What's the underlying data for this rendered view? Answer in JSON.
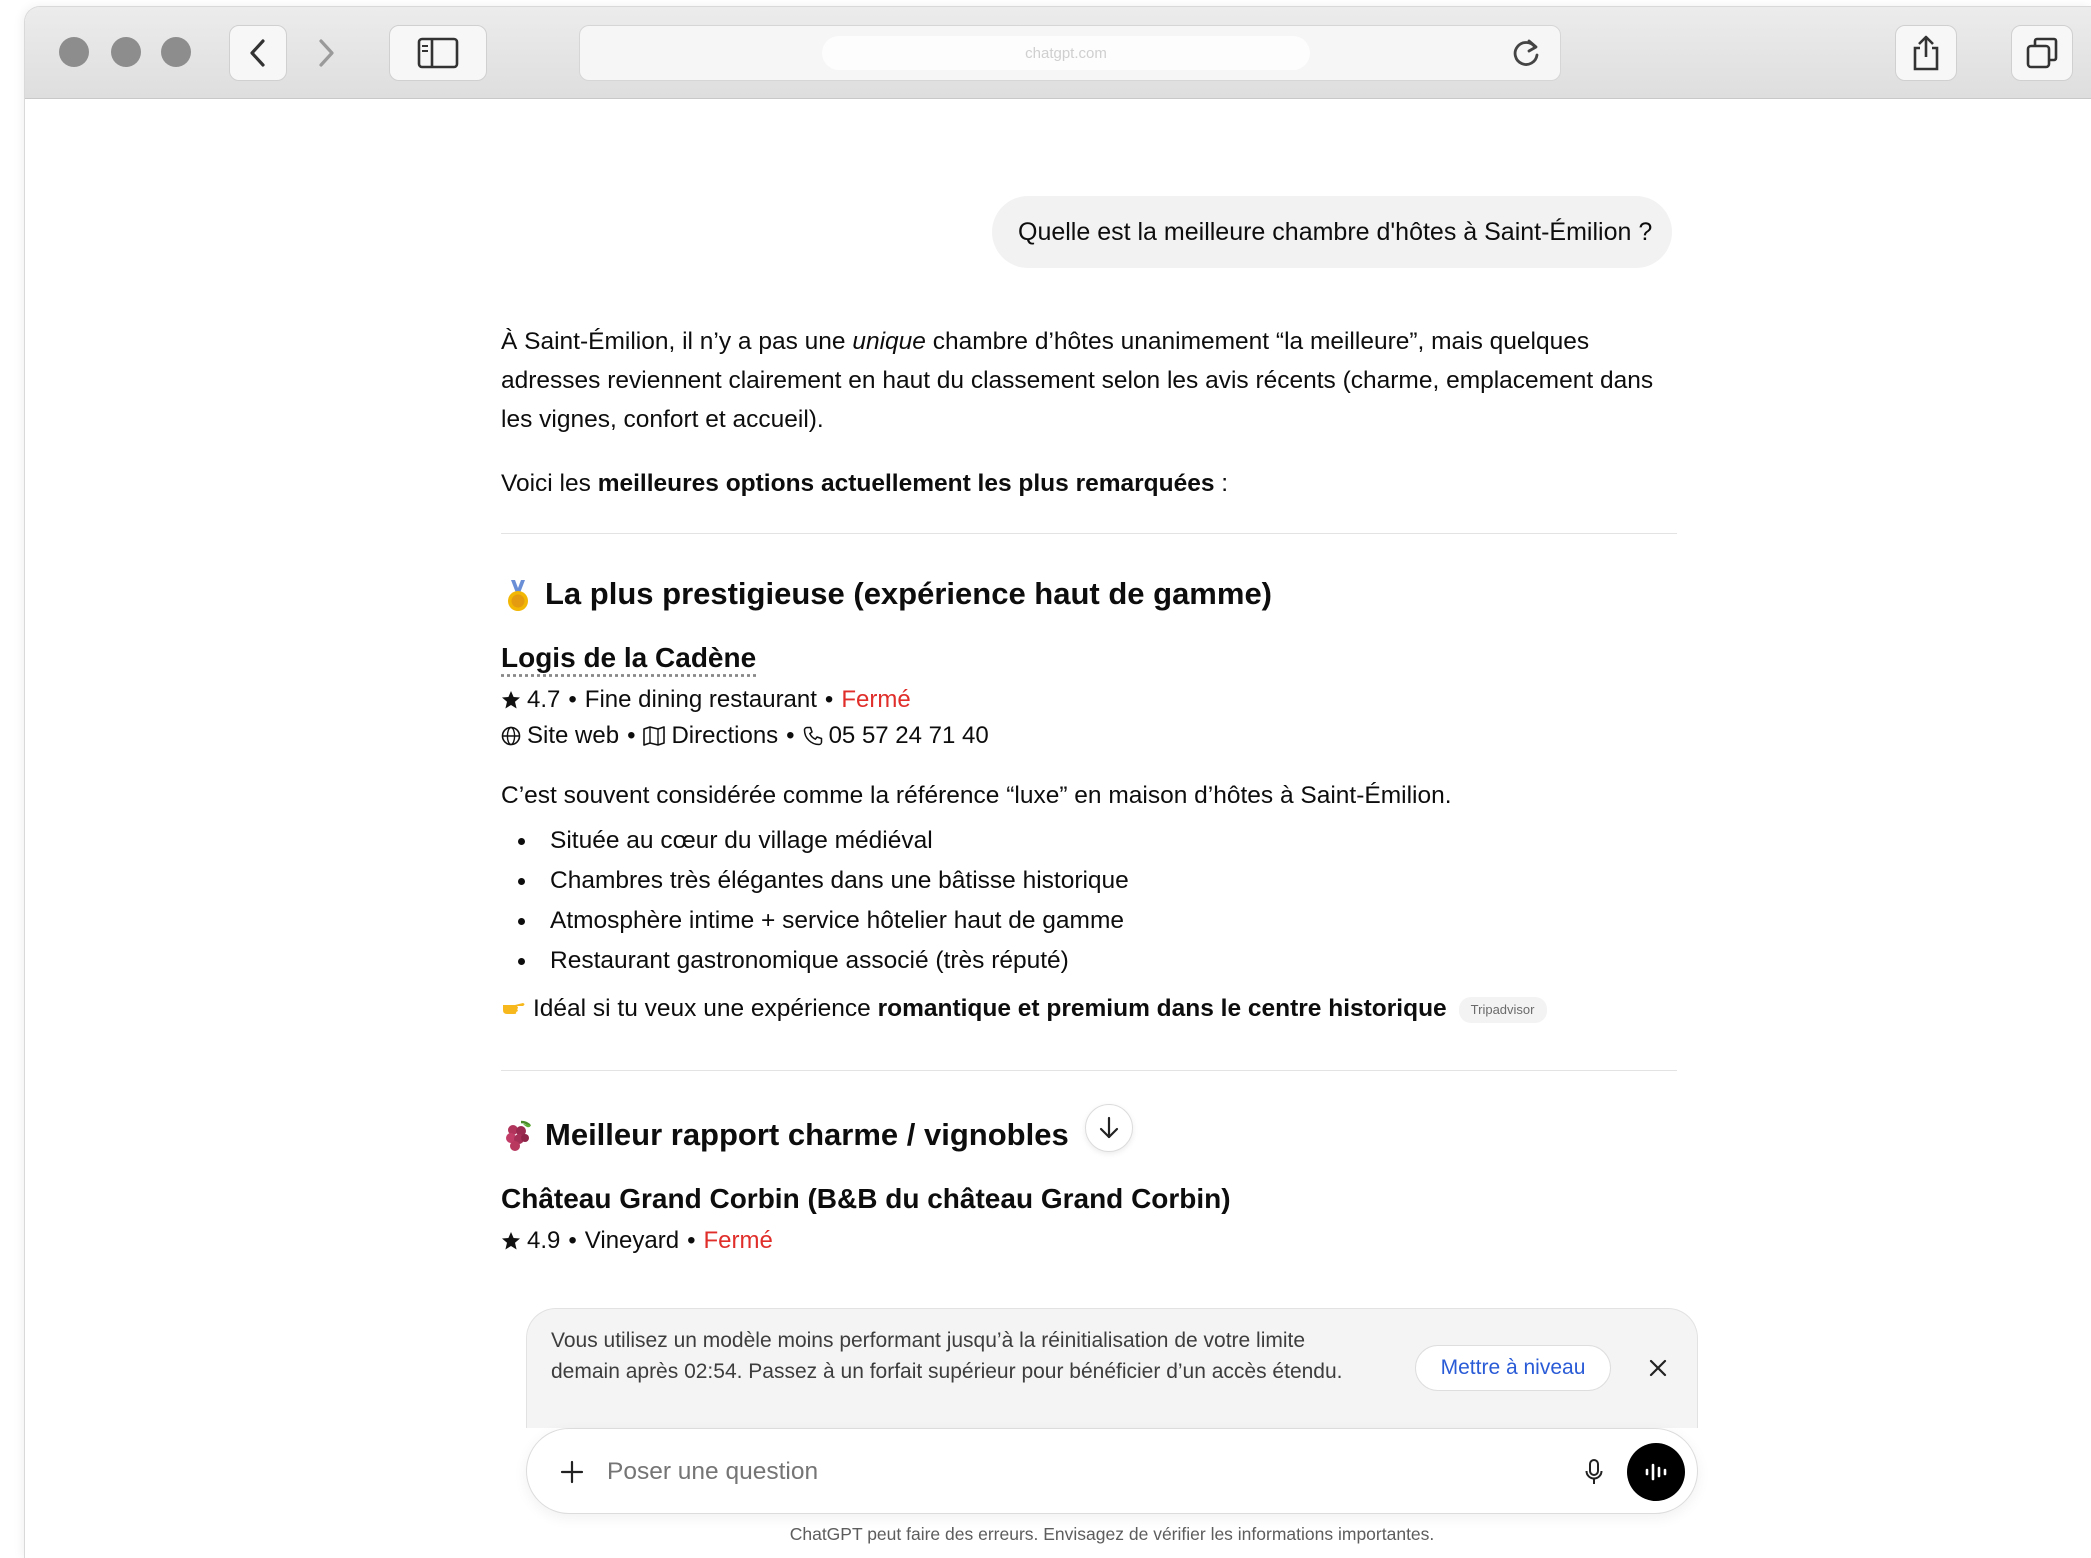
{
  "browser": {
    "address_text": "chatgpt.com",
    "icons": [
      "back-icon",
      "forward-icon",
      "sidebar-icon",
      "reload-icon",
      "share-icon",
      "tabs-icon"
    ]
  },
  "chat": {
    "user_message": "Quelle est la meilleure chambre d'hôtes à Saint-Émilion ?",
    "intro": {
      "part1": "À Saint-Émilion, il n’y a pas une ",
      "emphasis": "unique",
      "part2": " chambre d’hôtes unanimement “la meilleure”, mais quelques adresses reviennent clairement en haut du classement selon les avis récents (charme, emplacement dans les vignes, confort et accueil)."
    },
    "options_line": {
      "prefix": "Voici les ",
      "bold": "meilleures options actuellement les plus remarquées",
      "suffix": " :"
    },
    "sections": [
      {
        "emoji": "medal",
        "heading": "La plus prestigieuse (expérience haut de gamme)",
        "place": "Logis de la Cadène",
        "rating": "4.7",
        "category": "Fine dining restaurant",
        "status": "Fermé",
        "site": "Site web",
        "directions": "Directions",
        "phone": "05 57 24 71 40",
        "description": "C’est souvent considérée comme la référence “luxe” en maison d’hôtes à Saint-Émilion.",
        "bullets": [
          "Située au cœur du village médiéval",
          "Chambres très élégantes dans une bâtisse historique",
          "Atmosphère intime + service hôtelier haut de gamme",
          "Restaurant gastronomique associé (très réputé)"
        ],
        "ideal_prefix": "Idéal si tu veux une expérience ",
        "ideal_bold": "romantique et premium dans le centre historique",
        "source": "Tripadvisor"
      },
      {
        "emoji": "grapes",
        "heading": "Meilleur rapport charme / vignobles",
        "place": "Château Grand Corbin",
        "place_suffix": " (B&B du château Grand Corbin)",
        "rating": "4.9",
        "category": "Vineyard",
        "status": "Fermé"
      }
    ]
  },
  "notice": {
    "text": "Vous utilisez un modèle moins performant jusqu’à la réinitialisation de votre limite demain après 02:54. Passez à un forfait supérieur pour bénéficier d’un accès étendu.",
    "upgrade_label": "Mettre à niveau"
  },
  "composer": {
    "placeholder": "Poser une question"
  },
  "disclaimer": "ChatGPT peut faire des erreurs. Envisagez de vérifier les informations importantes.",
  "colors": {
    "closed_status": "#e02e2a",
    "upgrade_link": "#2a5bd7",
    "voice_button": "#000000"
  }
}
